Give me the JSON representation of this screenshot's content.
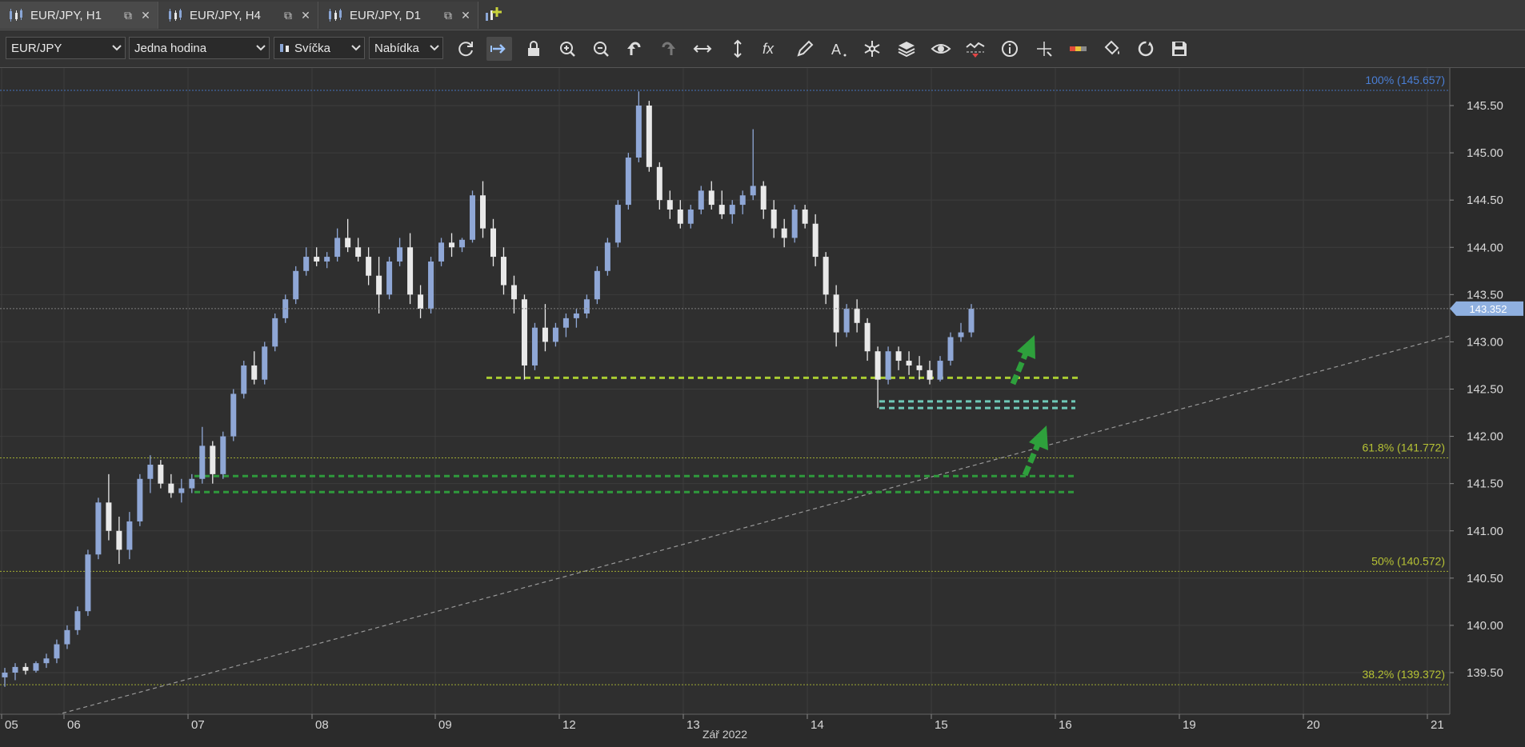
{
  "tabs": [
    {
      "label": "EUR/JPY, H1",
      "active": true
    },
    {
      "label": "EUR/JPY, H4",
      "active": false
    },
    {
      "label": "EUR/JPY, D1",
      "active": false
    }
  ],
  "toolbar": {
    "instrument": "EUR/JPY",
    "period": "Jedna hodina",
    "chart_type": "Svíčka",
    "price_side": "Nabídka",
    "icons": [
      "refresh-icon",
      "autoscroll-icon",
      "lock-icon",
      "zoom-in-icon",
      "zoom-out-icon",
      "undo-icon",
      "redo-icon",
      "horizontal-scale-icon",
      "vertical-scale-icon",
      "indicators-fx-icon",
      "pencil-icon",
      "text-tool-icon",
      "star-tool-icon",
      "layers-icon",
      "eye-icon",
      "chart-alert-icon",
      "info-icon",
      "crosshair-icon",
      "color-theme-icon",
      "paint-bucket-icon",
      "reset-icon",
      "save-icon"
    ]
  },
  "chart_data": {
    "type": "candlestick",
    "instrument": "EUR/JPY",
    "timeframe": "H1",
    "ylim": [
      139.1,
      145.85
    ],
    "y_ticks": [
      "145.50",
      "145.00",
      "144.50",
      "144.00",
      "143.50",
      "143.00",
      "142.50",
      "142.00",
      "141.50",
      "141.00",
      "140.50",
      "140.00",
      "139.50"
    ],
    "x_ticks": [
      "05",
      "06",
      "07",
      "08",
      "09",
      "12",
      "13",
      "14",
      "15",
      "16",
      "19",
      "20",
      "21"
    ],
    "x_axis_label": "Zář 2022",
    "current_price": "143.352",
    "fibonacci_levels": [
      {
        "label": "100% (145.657)",
        "value": 145.657,
        "color": "#4a7fd6"
      },
      {
        "label": "61.8% (141.772)",
        "value": 141.772,
        "color": "#b6c234"
      },
      {
        "label": "50% (140.572)",
        "value": 140.572,
        "color": "#b6c234"
      },
      {
        "label": "38.2% (139.372)",
        "value": 139.372,
        "color": "#b6c234"
      }
    ],
    "horizontal_levels": [
      {
        "value": 142.62,
        "from": "09",
        "to": "16",
        "color": "#a9cc32"
      },
      {
        "value": 142.37,
        "from": "14",
        "to": "16",
        "color": "#6fc9b8"
      },
      {
        "value": 142.3,
        "from": "14",
        "to": "16",
        "color": "#6fc9b8"
      },
      {
        "value": 141.58,
        "from": "07",
        "to": "16",
        "color": "#2f9a3c"
      },
      {
        "value": 141.41,
        "from": "07",
        "to": "16",
        "color": "#2f9a3c"
      }
    ],
    "candles": [
      [
        139.45,
        139.55,
        139.35,
        139.5
      ],
      [
        139.5,
        139.6,
        139.42,
        139.56
      ],
      [
        139.56,
        139.6,
        139.48,
        139.52
      ],
      [
        139.52,
        139.62,
        139.5,
        139.6
      ],
      [
        139.6,
        139.7,
        139.55,
        139.65
      ],
      [
        139.65,
        139.85,
        139.6,
        139.8
      ],
      [
        139.8,
        140.0,
        139.75,
        139.95
      ],
      [
        139.95,
        140.2,
        139.9,
        140.15
      ],
      [
        140.15,
        140.8,
        140.1,
        140.75
      ],
      [
        140.75,
        141.35,
        140.7,
        141.3
      ],
      [
        141.3,
        141.6,
        140.9,
        141.0
      ],
      [
        141.0,
        141.15,
        140.65,
        140.8
      ],
      [
        140.8,
        141.2,
        140.7,
        141.1
      ],
      [
        141.1,
        141.6,
        141.05,
        141.55
      ],
      [
        141.55,
        141.8,
        141.4,
        141.7
      ],
      [
        141.7,
        141.75,
        141.45,
        141.5
      ],
      [
        141.5,
        141.6,
        141.35,
        141.4
      ],
      [
        141.4,
        141.55,
        141.3,
        141.45
      ],
      [
        141.45,
        141.6,
        141.4,
        141.55
      ],
      [
        141.55,
        142.1,
        141.5,
        141.9
      ],
      [
        141.9,
        141.95,
        141.5,
        141.6
      ],
      [
        141.6,
        142.05,
        141.55,
        142.0
      ],
      [
        142.0,
        142.5,
        141.95,
        142.45
      ],
      [
        142.45,
        142.8,
        142.4,
        142.75
      ],
      [
        142.75,
        142.9,
        142.55,
        142.6
      ],
      [
        142.6,
        143.0,
        142.55,
        142.95
      ],
      [
        142.95,
        143.3,
        142.9,
        143.25
      ],
      [
        143.25,
        143.5,
        143.2,
        143.45
      ],
      [
        143.45,
        143.8,
        143.4,
        143.75
      ],
      [
        143.75,
        144.0,
        143.7,
        143.9
      ],
      [
        143.9,
        144.0,
        143.8,
        143.85
      ],
      [
        143.85,
        143.95,
        143.78,
        143.9
      ],
      [
        143.9,
        144.2,
        143.85,
        144.1
      ],
      [
        144.1,
        144.3,
        143.95,
        144.0
      ],
      [
        144.0,
        144.1,
        143.85,
        143.9
      ],
      [
        143.9,
        144.0,
        143.6,
        143.7
      ],
      [
        143.7,
        143.9,
        143.3,
        143.5
      ],
      [
        143.5,
        143.9,
        143.45,
        143.85
      ],
      [
        143.85,
        144.1,
        143.8,
        144.0
      ],
      [
        144.0,
        144.15,
        143.4,
        143.5
      ],
      [
        143.5,
        143.6,
        143.25,
        143.35
      ],
      [
        143.35,
        143.9,
        143.3,
        143.85
      ],
      [
        143.85,
        144.1,
        143.8,
        144.05
      ],
      [
        144.05,
        144.15,
        143.9,
        144.0
      ],
      [
        144.0,
        144.1,
        143.95,
        144.08
      ],
      [
        144.08,
        144.6,
        144.05,
        144.55
      ],
      [
        144.55,
        144.7,
        144.1,
        144.2
      ],
      [
        144.2,
        144.3,
        143.8,
        143.9
      ],
      [
        143.9,
        144.0,
        143.5,
        143.6
      ],
      [
        143.6,
        143.7,
        143.3,
        143.45
      ],
      [
        143.45,
        143.5,
        142.6,
        142.75
      ],
      [
        142.75,
        143.2,
        142.7,
        143.15
      ],
      [
        143.15,
        143.4,
        142.9,
        143.0
      ],
      [
        143.0,
        143.2,
        142.95,
        143.15
      ],
      [
        143.15,
        143.3,
        143.05,
        143.25
      ],
      [
        143.25,
        143.35,
        143.15,
        143.3
      ],
      [
        143.3,
        143.5,
        143.25,
        143.45
      ],
      [
        143.45,
        143.8,
        143.4,
        143.75
      ],
      [
        143.75,
        144.1,
        143.7,
        144.05
      ],
      [
        144.05,
        144.5,
        144.0,
        144.45
      ],
      [
        144.45,
        145.0,
        144.4,
        144.95
      ],
      [
        144.95,
        145.65,
        144.9,
        145.5
      ],
      [
        145.5,
        145.55,
        144.8,
        144.85
      ],
      [
        144.85,
        144.9,
        144.4,
        144.5
      ],
      [
        144.5,
        144.6,
        144.3,
        144.4
      ],
      [
        144.4,
        144.5,
        144.2,
        144.25
      ],
      [
        144.25,
        144.45,
        144.2,
        144.4
      ],
      [
        144.4,
        144.65,
        144.35,
        144.6
      ],
      [
        144.6,
        144.7,
        144.4,
        144.45
      ],
      [
        144.45,
        144.6,
        144.3,
        144.35
      ],
      [
        144.35,
        144.5,
        144.25,
        144.45
      ],
      [
        144.45,
        144.6,
        144.35,
        144.55
      ],
      [
        144.55,
        145.25,
        144.5,
        144.65
      ],
      [
        144.65,
        144.7,
        144.3,
        144.4
      ],
      [
        144.4,
        144.5,
        144.1,
        144.2
      ],
      [
        144.2,
        144.3,
        144.0,
        144.1
      ],
      [
        144.1,
        144.45,
        144.05,
        144.4
      ],
      [
        144.4,
        144.45,
        144.2,
        144.25
      ],
      [
        144.25,
        144.35,
        143.8,
        143.9
      ],
      [
        143.9,
        143.95,
        143.4,
        143.5
      ],
      [
        143.5,
        143.6,
        142.95,
        143.1
      ],
      [
        143.1,
        143.4,
        143.05,
        143.35
      ],
      [
        143.35,
        143.45,
        143.1,
        143.2
      ],
      [
        143.2,
        143.25,
        142.8,
        142.9
      ],
      [
        142.9,
        142.95,
        142.3,
        142.6
      ],
      [
        142.6,
        142.95,
        142.55,
        142.9
      ],
      [
        142.9,
        142.95,
        142.7,
        142.8
      ],
      [
        142.8,
        142.9,
        142.65,
        142.75
      ],
      [
        142.75,
        142.85,
        142.6,
        142.7
      ],
      [
        142.7,
        142.8,
        142.55,
        142.6
      ],
      [
        142.6,
        142.85,
        142.58,
        142.8
      ],
      [
        142.8,
        143.1,
        142.75,
        143.05
      ],
      [
        143.05,
        143.2,
        143.0,
        143.1
      ],
      [
        143.1,
        143.4,
        143.05,
        143.35
      ]
    ]
  }
}
